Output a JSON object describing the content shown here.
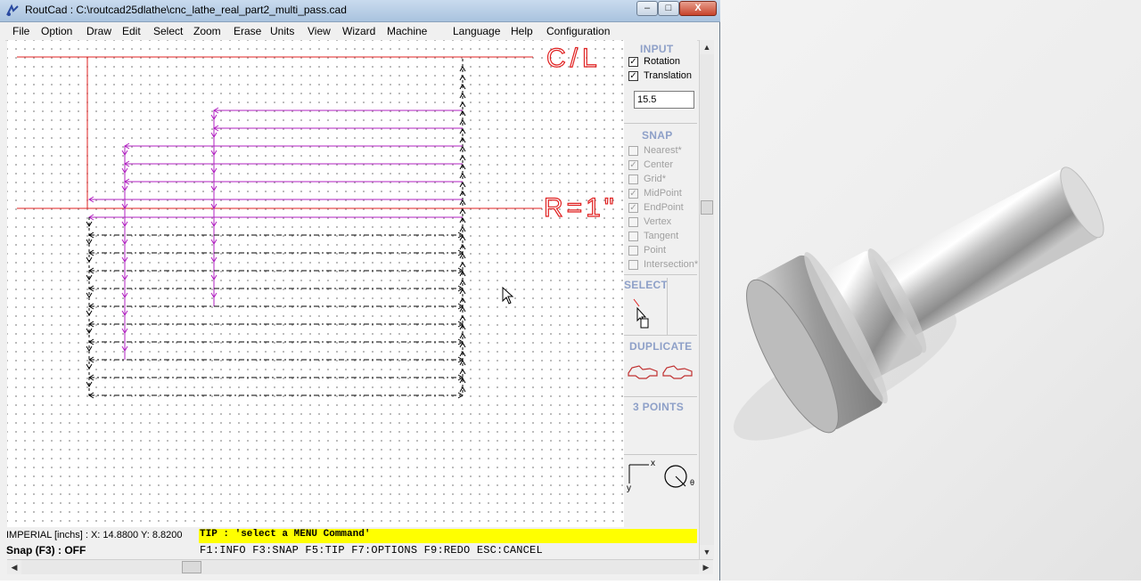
{
  "window": {
    "title": "RoutCad : C:\\routcad25dlathe\\cnc_lathe_real_part2_multi_pass.cad",
    "buttons": {
      "minimize": "–",
      "maximize": "□",
      "close": "X"
    }
  },
  "menu": [
    "File",
    "Option",
    "Draw",
    "Edit",
    "Select",
    "Zoom",
    "Erase",
    "Units",
    "View",
    "Wizard",
    "Machine",
    "Language",
    "Help",
    "Configuration"
  ],
  "canvas": {
    "centerline_label": "C/L",
    "radius_label": "R=1\""
  },
  "panel": {
    "input": {
      "title": "INPUT",
      "rotation": {
        "label": "Rotation",
        "checked": true
      },
      "translation": {
        "label": "Translation",
        "checked": true
      },
      "value": "15.5"
    },
    "snap": {
      "title": "SNAP",
      "options": [
        {
          "label": "Nearest*",
          "checked": false
        },
        {
          "label": "Center",
          "checked": true
        },
        {
          "label": "Grid*",
          "checked": false
        },
        {
          "label": "MidPoint",
          "checked": true
        },
        {
          "label": "EndPoint",
          "checked": true
        },
        {
          "label": "Vertex",
          "checked": false
        },
        {
          "label": "Tangent",
          "checked": false
        },
        {
          "label": "Point",
          "checked": false
        },
        {
          "label": "Intersection*",
          "checked": false
        }
      ]
    },
    "select": {
      "title": "SELECT"
    },
    "duplicate": {
      "title": "DUPLICATE"
    },
    "three_points": {
      "title": "3 POINTS"
    },
    "axes": {
      "x": "x",
      "y": "y",
      "theta": "θ"
    }
  },
  "status": {
    "coords": "IMPERIAL [inchs] : X: 14.8800  Y: 8.8200",
    "snap": "Snap (F3) : OFF",
    "tip": "TIP : 'select a MENU Command'",
    "fkeys": "F1:INFO  F3:SNAP  F5:TIP  F7:OPTIONS  F9:REDO  ESC:CANCEL"
  },
  "colors": {
    "red": "#e02020",
    "magenta": "#b020c0",
    "tip_yellow": "#ffff00",
    "panel_title": "#8ea0c8"
  }
}
